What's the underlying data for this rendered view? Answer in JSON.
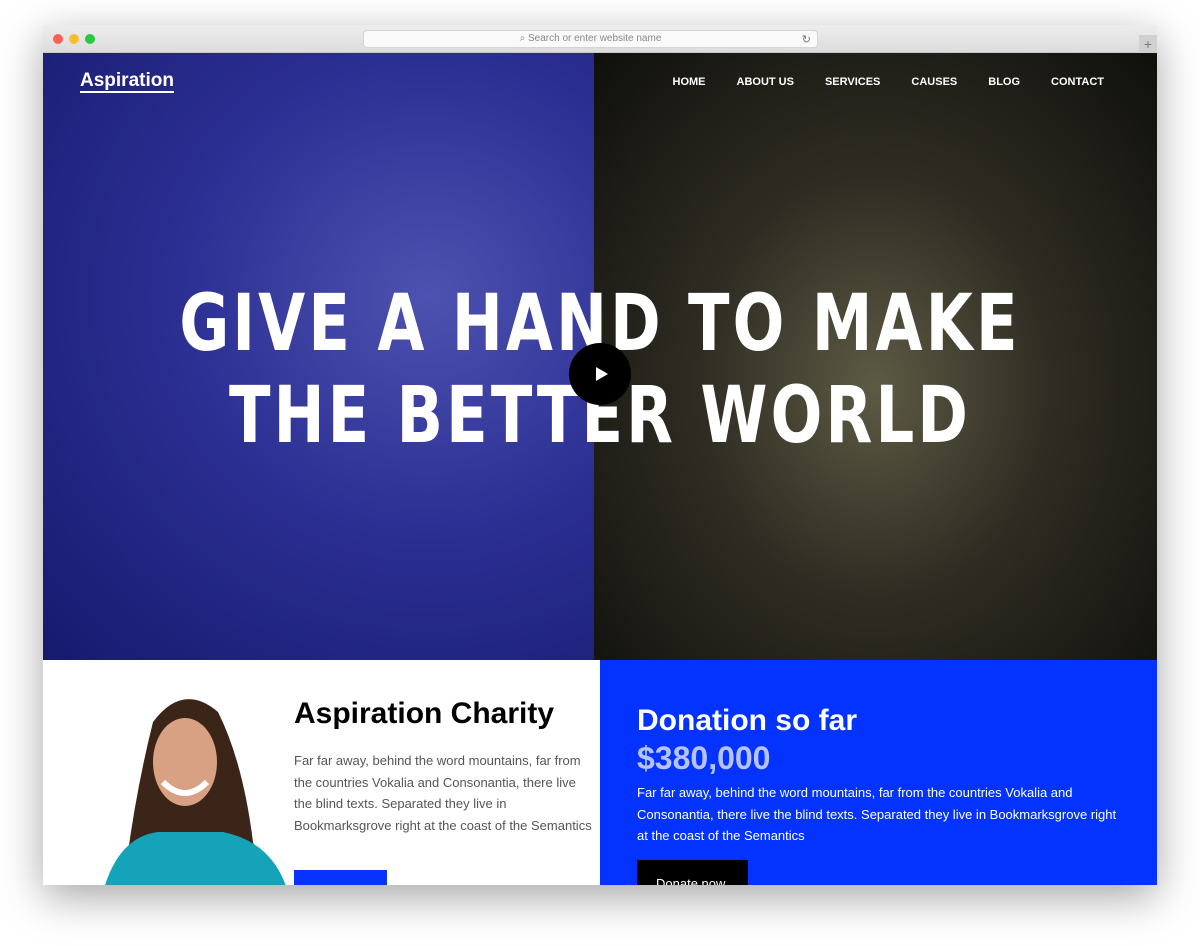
{
  "browser": {
    "url_placeholder": "Search or enter website name"
  },
  "header": {
    "logo": "Aspiration",
    "nav": [
      "HOME",
      "ABOUT US",
      "SERVICES",
      "CAUSES",
      "BLOG",
      "CONTACT"
    ]
  },
  "hero": {
    "title_line1": "GIVE A HAND TO MAKE",
    "title_line2": "THE BETTER WORLD"
  },
  "charity": {
    "title": "Aspiration Charity",
    "text": "Far far away, behind the word mountains, far from the countries Vokalia and Consonantia, there live the blind texts. Separated they live in Bookmarksgrove right at the coast of the Semantics"
  },
  "donation": {
    "title": "Donation so far",
    "amount": "$380,000",
    "text": "Far far away, behind the word mountains, far from the countries Vokalia and Consonantia, there live the blind texts. Separated they live in Bookmarksgrove right at the coast of the Semantics",
    "button": "Donate now"
  },
  "colors": {
    "accent": "#0433ff",
    "overlay": "#2c2f93"
  }
}
